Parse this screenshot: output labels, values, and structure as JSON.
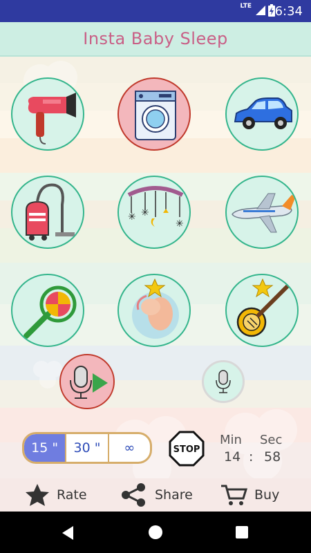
{
  "status": {
    "network": "LTE",
    "time": "6:34"
  },
  "app": {
    "title": "Insta Baby Sleep"
  },
  "sounds": [
    {
      "name": "hair-dryer",
      "icon": "hair-dryer-icon",
      "active": false
    },
    {
      "name": "washing-machine",
      "icon": "washing-machine-icon",
      "active": true
    },
    {
      "name": "car",
      "icon": "car-icon",
      "active": false
    },
    {
      "name": "vacuum-cleaner",
      "icon": "vacuum-cleaner-icon",
      "active": false
    },
    {
      "name": "crib-mobile",
      "icon": "crib-mobile-icon",
      "active": false
    },
    {
      "name": "airplane",
      "icon": "airplane-icon",
      "active": false
    },
    {
      "name": "rattle",
      "icon": "rattle-icon",
      "active": false
    },
    {
      "name": "womb",
      "icon": "womb-icon",
      "premium": true
    },
    {
      "name": "banjo",
      "icon": "banjo-icon",
      "premium": true
    }
  ],
  "timer": {
    "options": [
      "15 \"",
      "30 \"",
      "∞"
    ],
    "selected": 0
  },
  "stop": {
    "label": "STOP"
  },
  "countdown": {
    "min_label": "Min",
    "sec_label": "Sec",
    "minutes": "14",
    "separator": ":",
    "seconds": "58"
  },
  "bottom": {
    "rate": "Rate",
    "share": "Share",
    "buy": "Buy"
  },
  "colors": {
    "statusbar": "#2f3aa0",
    "title": "#c95f86",
    "tile_border": "#34b58c",
    "active_border": "#c0392b",
    "selected_timer": "#6f7de0"
  }
}
